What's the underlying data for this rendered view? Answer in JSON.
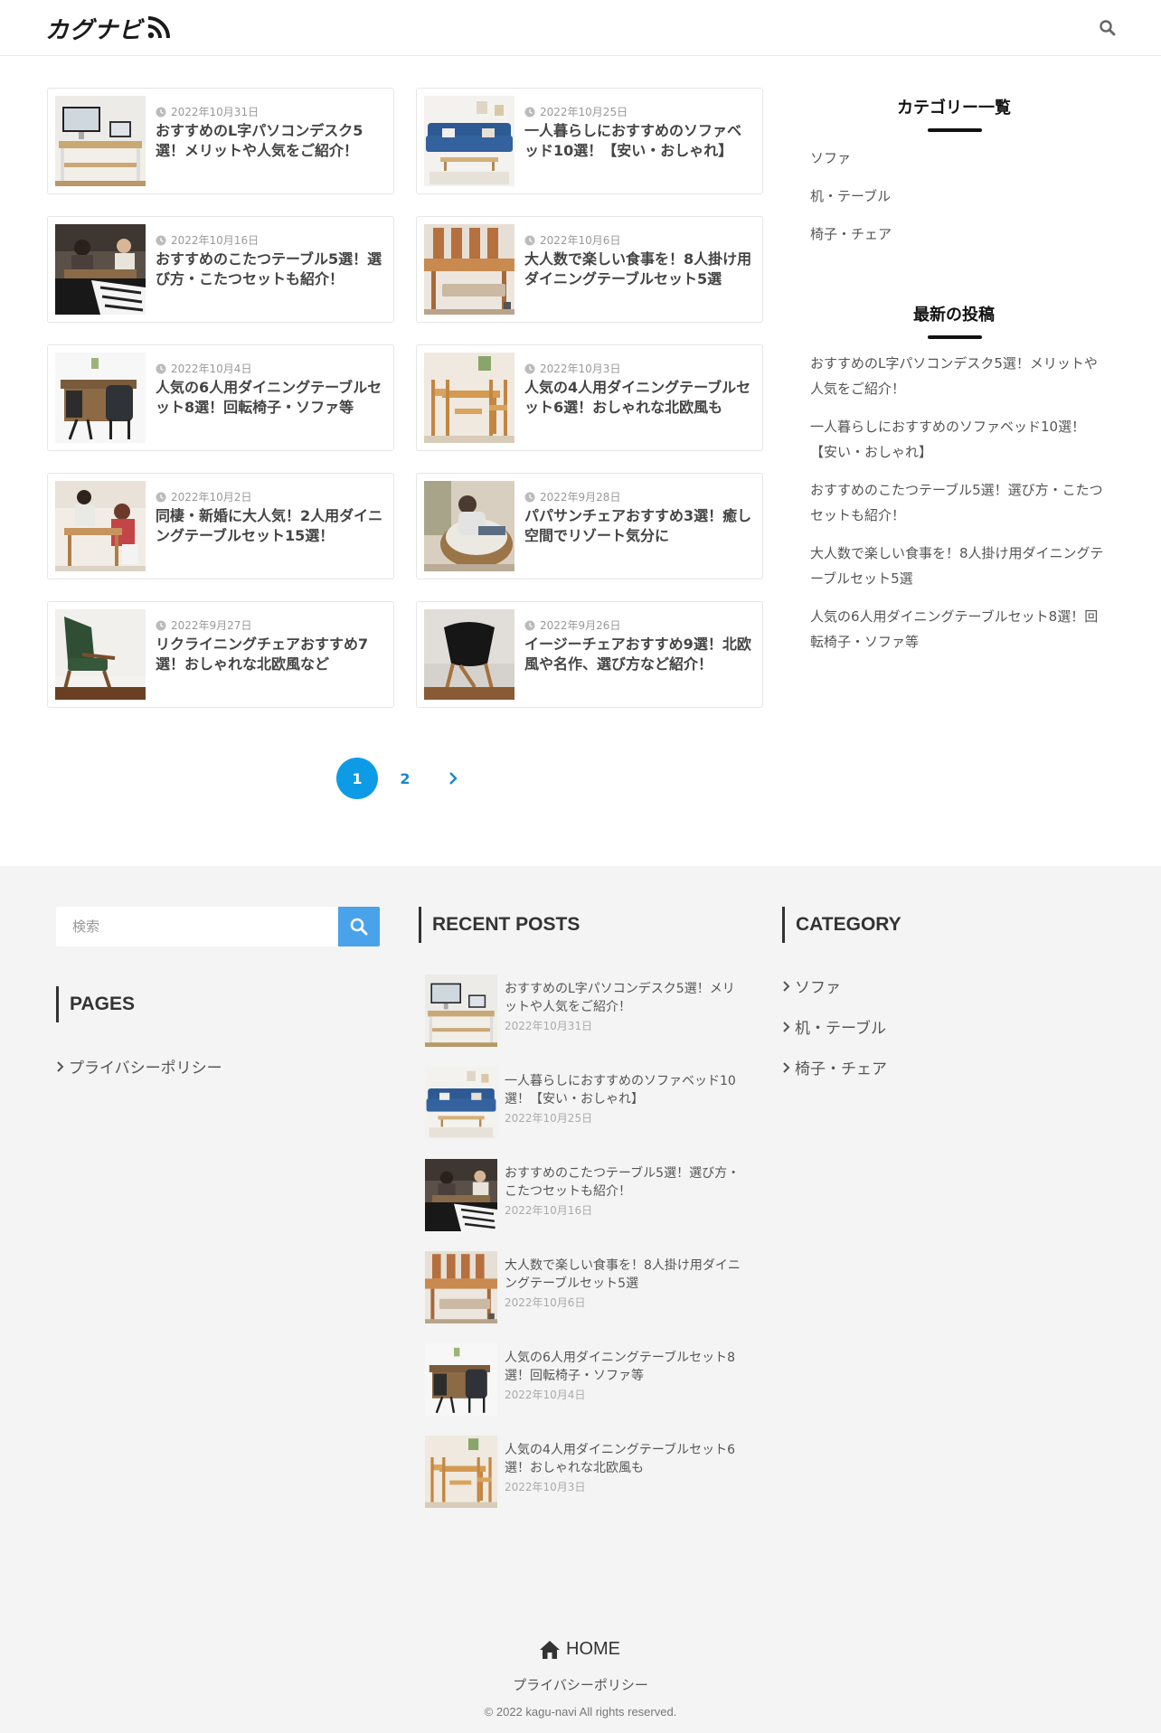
{
  "header": {
    "logo_text": "カグナビ",
    "logo_icon": "rss-icon",
    "search_icon": "search-icon"
  },
  "posts": [
    {
      "date": "2022年10月31日",
      "title": "おすすめのL字パソコンデスク5選！メリットや人気をご紹介！"
    },
    {
      "date": "2022年10月25日",
      "title": "一人暮らしにおすすめのソファベッド10選！【安い・おしゃれ】"
    },
    {
      "date": "2022年10月16日",
      "title": "おすすめのこたつテーブル5選！選び方・こたつセットも紹介！"
    },
    {
      "date": "2022年10月6日",
      "title": "大人数で楽しい食事を！8人掛け用ダイニングテーブルセット5選"
    },
    {
      "date": "2022年10月4日",
      "title": "人気の6人用ダイニングテーブルセット8選！回転椅子・ソファ等"
    },
    {
      "date": "2022年10月3日",
      "title": "人気の4人用ダイニングテーブルセット6選！おしゃれな北欧風も"
    },
    {
      "date": "2022年10月2日",
      "title": "同棲・新婚に大人気！2人用ダイニングテーブルセット15選！"
    },
    {
      "date": "2022年9月28日",
      "title": "パパサンチェアおすすめ3選！癒し空間でリゾート気分に"
    },
    {
      "date": "2022年9月27日",
      "title": "リクライニングチェアおすすめ7選！おしゃれな北欧風など"
    },
    {
      "date": "2022年9月26日",
      "title": "イージーチェアおすすめ9選！北欧風や名作、選び方など紹介！"
    }
  ],
  "pagination": {
    "current": "1",
    "next_page": "2",
    "next_icon": "chevron-right-icon"
  },
  "sidebar": {
    "category_heading": "カテゴリー一覧",
    "categories": [
      "ソファ",
      "机・テーブル",
      "椅子・チェア"
    ],
    "recent_heading": "最新の投稿",
    "recent": [
      "おすすめのL字パソコンデスク5選！メリットや人気をご紹介！",
      "一人暮らしにおすすめのソファベッド10選！【安い・おしゃれ】",
      "おすすめのこたつテーブル5選！選び方・こたつセットも紹介！",
      "大人数で楽しい食事を！8人掛け用ダイニングテーブルセット5選",
      "人気の6人用ダイニングテーブルセット8選！回転椅子・ソファ等"
    ]
  },
  "footer": {
    "search_placeholder": "検索",
    "pages_heading": "PAGES",
    "pages": [
      "プライバシーポリシー"
    ],
    "recent_heading": "RECENT POSTS",
    "recent": [
      {
        "title": "おすすめのL字パソコンデスク5選！メリットや人気をご紹介！",
        "date": "2022年10月31日"
      },
      {
        "title": "一人暮らしにおすすめのソファベッド10選！【安い・おしゃれ】",
        "date": "2022年10月25日"
      },
      {
        "title": "おすすめのこたつテーブル5選！選び方・こたつセットも紹介！",
        "date": "2022年10月16日"
      },
      {
        "title": "大人数で楽しい食事を！8人掛け用ダイニングテーブルセット5選",
        "date": "2022年10月6日"
      },
      {
        "title": "人気の6人用ダイニングテーブルセット8選！回転椅子・ソファ等",
        "date": "2022年10月4日"
      },
      {
        "title": "人気の4人用ダイニングテーブルセット6選！おしゃれな北欧風も",
        "date": "2022年10月3日"
      }
    ],
    "category_heading": "CATEGORY",
    "categories": [
      "ソファ",
      "机・テーブル",
      "椅子・チェア"
    ],
    "home_label": "HOME",
    "privacy_label": "プライバシーポリシー",
    "copyright": "© 2022 kagu-navi All rights reserved."
  },
  "colors": {
    "accent": "#0e9be6",
    "search_button": "#4aa3ea",
    "footer_bg": "#f4f4f4"
  }
}
